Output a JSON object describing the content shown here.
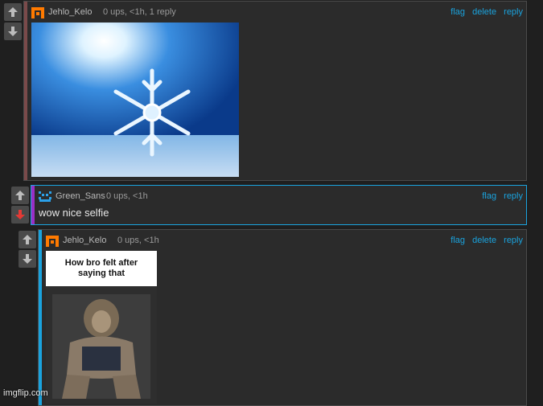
{
  "comments": [
    {
      "author": "Jehlo_Kelo",
      "meta": "0 ups, <1h, 1 reply",
      "actions": [
        "flag",
        "delete",
        "reply"
      ],
      "image_description": "snowflake",
      "avatar_color": "#ff7a00",
      "bar_color": "#7a4a4a"
    },
    {
      "author": "Green_Sans",
      "meta": "0 ups, <1h",
      "actions": [
        "flag",
        "reply"
      ],
      "text": "wow nice selfie",
      "avatar_color": "#2ba0e8",
      "bar_color": "#9b2fc5",
      "downvoted": true
    },
    {
      "author": "Jehlo_Kelo",
      "meta": "0 ups, <1h",
      "actions": [
        "flag",
        "delete",
        "reply"
      ],
      "meme_caption": "How bro felt after saying that",
      "avatar_color": "#ff7a00",
      "bar_color": "#1aa3de"
    }
  ],
  "watermark": "imgflip.com",
  "colors": {
    "link": "#1aa3de",
    "downvote_active": "#e53935"
  }
}
